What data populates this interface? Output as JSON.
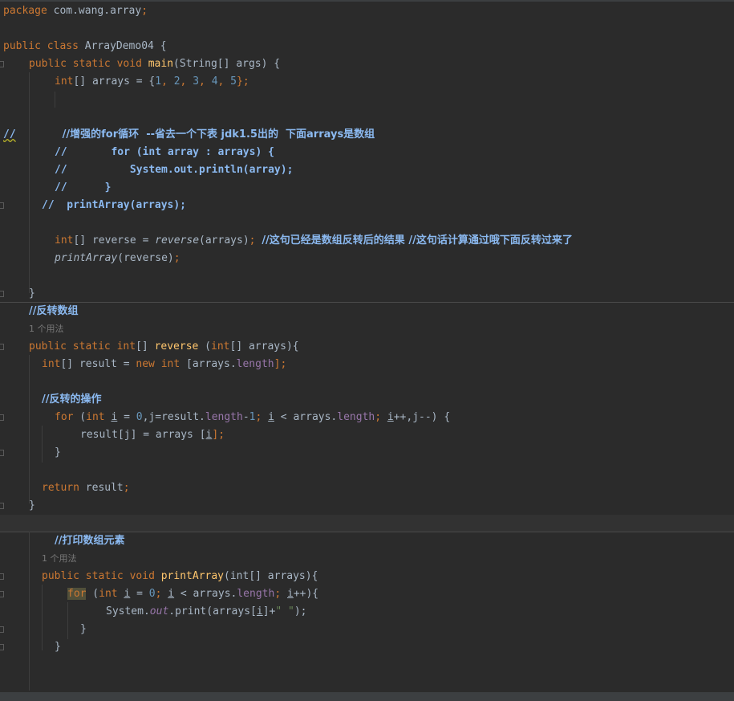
{
  "code": {
    "package_kw": "package",
    "package_name": " com.wang.array",
    "semi": ";",
    "public": "public",
    "class": "class",
    "class_name": "ArrayDemo04",
    "open_brace": "{",
    "close_brace": "}",
    "static": "static",
    "void": "void",
    "main": "main",
    "main_params": "(String[] args) {",
    "int": "int",
    "arrays_decl": "[] arrays = {",
    "n1": "1",
    "n2": "2",
    "n3": "3",
    "n4": "4",
    "n5": "5",
    "comma": ", ",
    "arrays_decl_end": "};",
    "line6_slash": "//",
    "line6_comment": "//增强的for循环  --省去一个下表 jdk1.5出的  下面arrays是数组",
    "line7": "//       for (int array : arrays) {",
    "line8": "//          System.out.println(array);",
    "line9": "//      }",
    "line10": "//  printArray(arrays);",
    "reverse_decl": "[] reverse = ",
    "reverse_call": "reverse",
    "reverse_args": "(arrays)",
    "reverse_comment": "//这句已经是数组反转后的结果 //这句话计算通过哦下面反转过来了",
    "printArray": "printArray",
    "print_reverse_args": "(reverse)",
    "comment_reverse_array": "//反转数组",
    "usage_hint": "1 个用法",
    "reverse_sig_rest": " (",
    "reverse_sig_params": "[] arrays){",
    "brackets": "[]",
    "result_decl": "[] result = ",
    "new": "new",
    "result_new_rest": " [arrays.",
    "length": "length",
    "bracket_close_semi": "];",
    "comment_reverse_op": "//反转的操作",
    "for": "for",
    "paren_open": " (",
    "i": "i",
    "assign": " = ",
    "n0": "0",
    "for1_mid": ",j=result.",
    "minus1": "-",
    "n_1": "1",
    "semi_space": "; ",
    "lt_arrays": " < arrays.",
    "incr": "++,j--) {",
    "result_assign": "result[j] = arrays [",
    "return": "return",
    "result_ret": " result",
    "comment_print": "//打印数组元素",
    "print_params": "(int[] arrays){",
    "for2_incr": "++){",
    "system": "System.",
    "out": "out",
    "print_call": ".print(arrays[",
    "print_plus": "]+",
    "print_str": "\" \"",
    "print_end": ");"
  },
  "colors": {
    "background": "#2b2b2b",
    "keyword": "#cc7832",
    "function": "#ffc66d",
    "number": "#6897bb",
    "field": "#9876aa",
    "string": "#6a8759",
    "comment": "#8bb9f0",
    "text": "#a9b7c6"
  }
}
